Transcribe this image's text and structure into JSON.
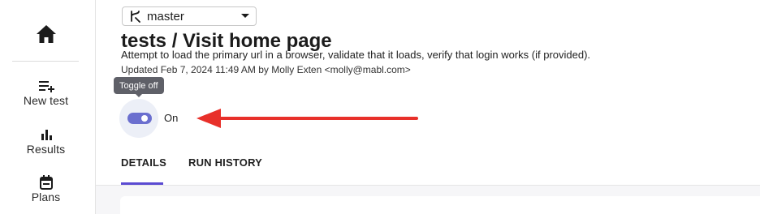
{
  "sidebar": {
    "home_icon": "home-icon",
    "items": [
      {
        "label": "New test",
        "icon": "new-test-icon"
      },
      {
        "label": "Results",
        "icon": "results-chart-icon"
      },
      {
        "label": "Plans",
        "icon": "plans-calendar-icon"
      }
    ]
  },
  "branch": {
    "name": "master",
    "icon": "branch-icon"
  },
  "test": {
    "title": "tests / Visit home page",
    "description": "Attempt to load the primary url in a browser, validate that it loads, verify that login works (if provided).",
    "updated": "Updated Feb 7, 2024 11:49 AM by Molly Exten <molly@mabl.com>"
  },
  "toggle": {
    "tooltip": "Toggle off",
    "state_label": "On",
    "checked": true,
    "color": "#6b6fcf"
  },
  "annotation": {
    "arrow_color": "#e8302a"
  },
  "tabs": [
    {
      "label": "DETAILS",
      "active": true
    },
    {
      "label": "RUN HISTORY",
      "active": false
    }
  ],
  "colors": {
    "accent": "#5b4bd2"
  }
}
